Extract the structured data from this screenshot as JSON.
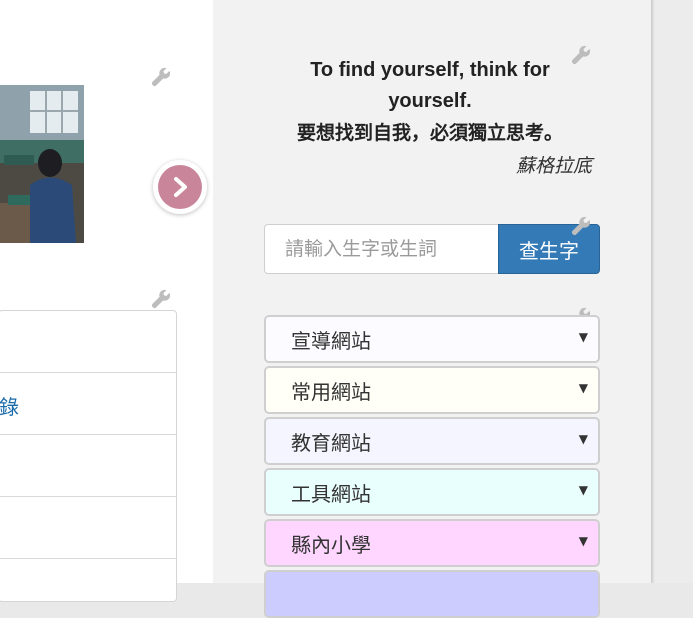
{
  "quote": {
    "english": "To find yourself, think for yourself.",
    "chinese": "要想找到自我，必須獨立思考。",
    "author": "蘇格拉底"
  },
  "search": {
    "placeholder": "請輸入生字或生詞",
    "button_label": "查生字"
  },
  "left_list": {
    "rows": [
      "",
      "錄",
      "",
      "",
      ""
    ]
  },
  "nav": {
    "icon": "chevron-right-icon"
  },
  "dropdowns": [
    {
      "label": "宣導網站",
      "color": "#fcfbff"
    },
    {
      "label": "常用網站",
      "color": "#fffff7"
    },
    {
      "label": "教育網站",
      "color": "#f5f5ff"
    },
    {
      "label": "工具網站",
      "color": "#e9fffd"
    },
    {
      "label": "縣內小學",
      "color": "#ffd6ff"
    },
    {
      "label": "",
      "color": "#ccccff"
    }
  ],
  "colors": {
    "accent_button": "#337ab7",
    "nav_circle": "#c9869a",
    "link": "#1a6aa8"
  }
}
